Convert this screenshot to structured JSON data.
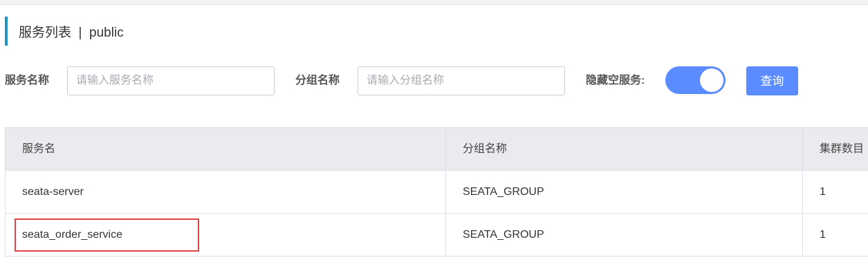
{
  "header": {
    "title": "服务列表  |  public"
  },
  "filters": {
    "service_name_label": "服务名称",
    "service_name_placeholder": "请输入服务名称",
    "service_name_value": "",
    "group_name_label": "分组名称",
    "group_name_placeholder": "请输入分组名称",
    "group_name_value": "",
    "hide_empty_label": "隐藏空服务:",
    "hide_empty_enabled": true,
    "search_button_label": "查询"
  },
  "table": {
    "columns": [
      "服务名",
      "分组名称",
      "集群数目"
    ],
    "rows": [
      [
        "seata-server",
        "SEATA_GROUP",
        "1"
      ],
      [
        "seata_order_service",
        "SEATA_GROUP",
        "1"
      ]
    ]
  },
  "colors": {
    "accent": "#5b8cff",
    "title_bar": "#1f94c3",
    "highlight_box": "#e04343",
    "header_bg": "#ebebef"
  }
}
